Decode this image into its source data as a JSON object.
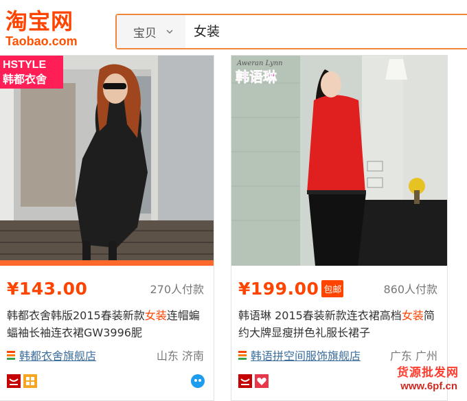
{
  "header": {
    "logo_cn": "淘宝网",
    "logo_en": "Taobao.com",
    "search_type": "宝贝",
    "search_value": "女装"
  },
  "products": [
    {
      "image_overlay": "HSTYLE\n韩都衣舍",
      "price": "¥143.00",
      "badge": "",
      "sales": "270人付款",
      "title_before": "韩都衣舍韩版2015春装新款",
      "title_highlight": "女装",
      "title_after": "连帽蝙蝠袖长袖连衣裙GW3996胒",
      "shop": "韩都衣舍旗舰店",
      "location": "山东 济南"
    },
    {
      "image_overlay_top": "Aweran Lynn",
      "image_overlay": "韩语琳",
      "price": "¥199.00",
      "badge": "包邮",
      "sales": "860人付款",
      "title_before": "韩语琳 2015春装新款连衣裙高档",
      "title_highlight": "女装",
      "title_after": "简约大牌显瘦拼色礼服长裙子",
      "shop": "韩语拼空间服饰旗舰店",
      "location": "广东 广州"
    }
  ],
  "watermark": {
    "text": "货源批发网",
    "url": "www.6pf.cn"
  },
  "colors": {
    "brand": "#ff4400",
    "search_border": "#f0853a",
    "link": "#3c6e9c"
  }
}
